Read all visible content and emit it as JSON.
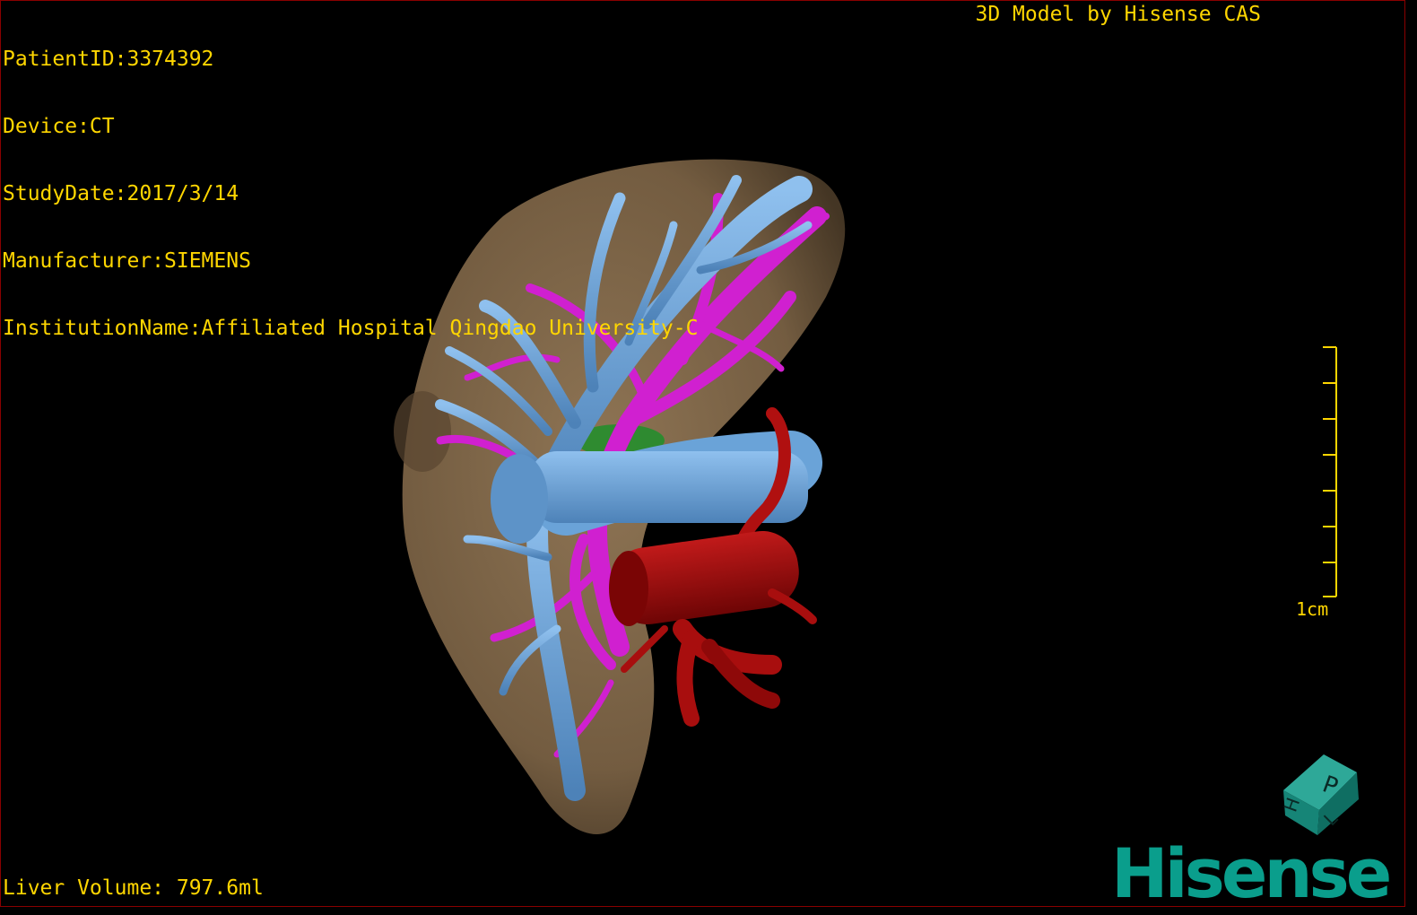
{
  "header": {
    "patient_id": "PatientID:3374392",
    "device": "Device:CT",
    "study_date": "StudyDate:2017/3/14",
    "manufacturer": "Manufacturer:SIEMENS",
    "institution": "InstitutionName:Affiliated Hospital Qingdao University-C",
    "credit": "3D Model by Hisense CAS"
  },
  "scale_bar": {
    "label": "1cm",
    "ticks": 8
  },
  "footer": {
    "volume": "Liver Volume: 797.6ml"
  },
  "orientation_cube": {
    "face_labels": [
      "P",
      "H",
      "L"
    ]
  },
  "brand": {
    "logo": "Hisense"
  },
  "colors": {
    "overlay_text": "#ffd600",
    "liver": "#8c7152",
    "portal_vein": "#6aa3d8",
    "hepatic_vein": "#d020d0",
    "artery": "#b01010",
    "brand": "#0a9e8c"
  },
  "model": {
    "structures": [
      "liver",
      "portal-vein",
      "hepatic-vein",
      "hepatic-artery",
      "gallbladder"
    ]
  }
}
